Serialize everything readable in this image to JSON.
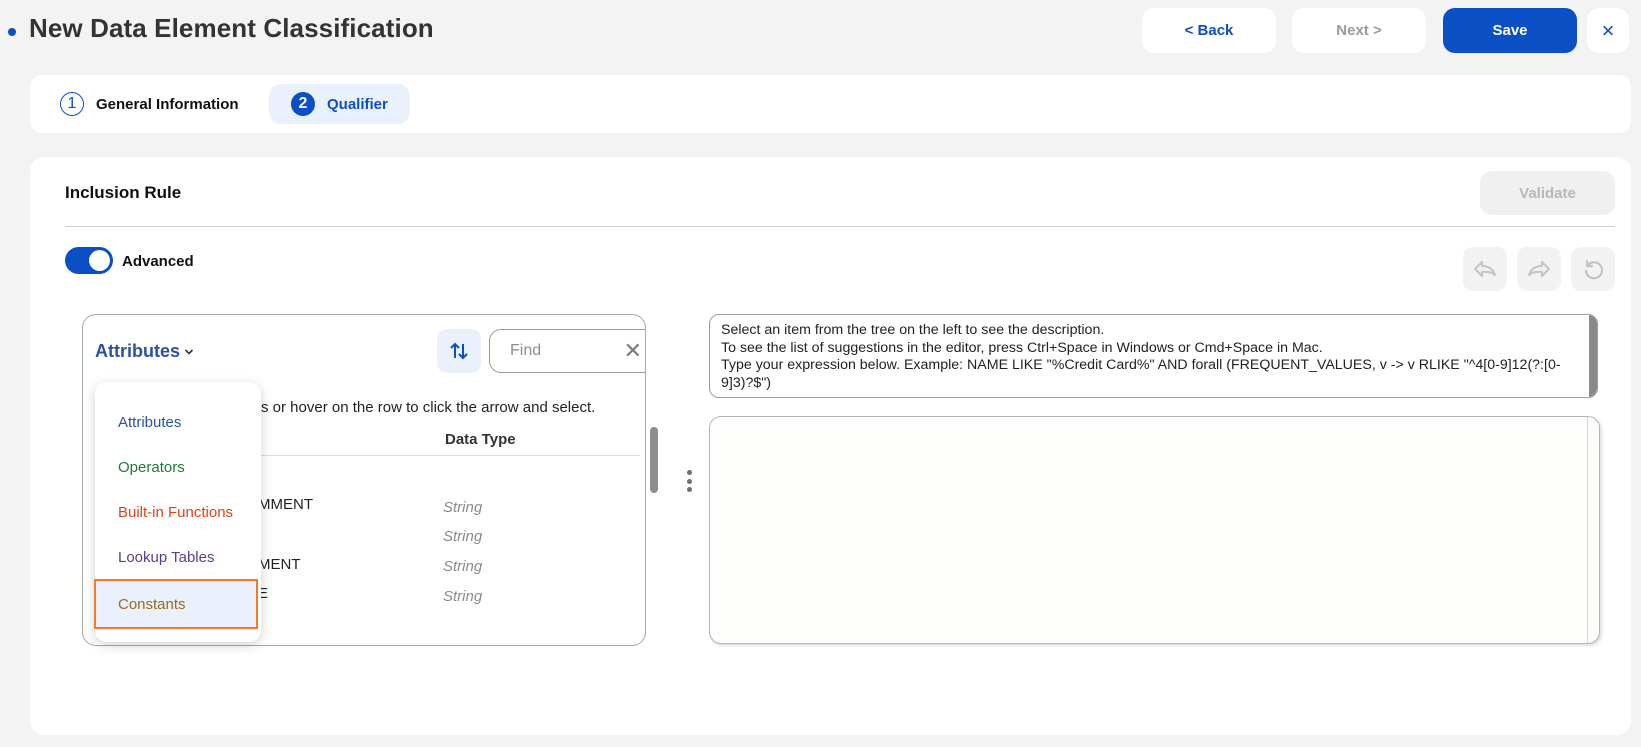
{
  "header": {
    "title": "New Data Element Classification",
    "back_label": "< Back",
    "next_label": "Next >",
    "save_label": "Save",
    "close_icon": "×"
  },
  "steps": [
    {
      "number": "1",
      "label": "General Information",
      "active": false
    },
    {
      "number": "2",
      "label": "Qualifier",
      "active": true
    }
  ],
  "card": {
    "title": "Inclusion Rule",
    "validate_label": "Validate",
    "toggle_label": "Advanced",
    "toggle_on": true,
    "toolbar_icons": [
      "undo-icon",
      "redo-icon",
      "reset-icon"
    ]
  },
  "left_panel": {
    "category_selected": "Attributes",
    "find_placeholder": "Find",
    "find_value": "",
    "hint_visible": "s or hover on the row to click the arrow and select.",
    "column_header": "Data Type",
    "rows": [
      {
        "name_visible": "MMENT",
        "type": "String"
      },
      {
        "name_visible": "",
        "type": "String"
      },
      {
        "name_visible": "MENT",
        "type": "String"
      },
      {
        "name_visible": "E",
        "type": "String"
      }
    ]
  },
  "category_menu": {
    "items": [
      {
        "label": "Attributes",
        "color": "#2c4fa8"
      },
      {
        "label": "Operators",
        "color": "#1e7a3c"
      },
      {
        "label": "Built-in Functions",
        "color": "#e0401a"
      },
      {
        "label": "Lookup Tables",
        "color": "#5b3d8f"
      },
      {
        "label": "Constants",
        "color": "#9a6b1c",
        "highlighted": true
      }
    ]
  },
  "description": {
    "line1": "Select an item from the tree on the left to see the description.",
    "line2": "To see the list of suggestions in the editor, press Ctrl+Space in Windows or Cmd+Space in Mac.",
    "line3": "Type your expression below. Example: NAME LIKE \"%Credit Card%\" AND forall (FREQUENT_VALUES, v -> v RLIKE \"^4[0-9]12(?:[0-9]3)?$\")"
  },
  "editor": {
    "value": ""
  },
  "colors": {
    "accent": "#0b4fc4",
    "highlight_border": "#f07b28",
    "active_step_bg": "#eaf1fd"
  }
}
